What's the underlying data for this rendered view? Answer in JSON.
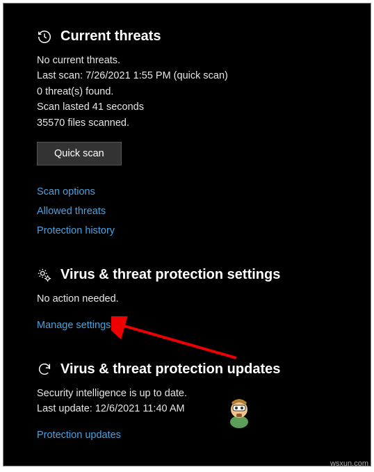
{
  "threats": {
    "title": "Current threats",
    "no_threats": "No current threats.",
    "last_scan": "Last scan: 7/26/2021 1:55 PM (quick scan)",
    "found": "0 threat(s) found.",
    "duration": "Scan lasted 41 seconds",
    "files": "35570 files scanned.",
    "quick_scan_btn": "Quick scan",
    "scan_options": "Scan options",
    "allowed_threats": "Allowed threats",
    "protection_history": "Protection history"
  },
  "settings": {
    "title": "Virus & threat protection settings",
    "status": "No action needed.",
    "manage": "Manage settings"
  },
  "updates": {
    "title": "Virus & threat protection updates",
    "status": "Security intelligence is up to date.",
    "last_update": "Last update: 12/6/2021 11:40 AM",
    "protection_updates": "Protection updates"
  },
  "watermark": "wsxun.com"
}
